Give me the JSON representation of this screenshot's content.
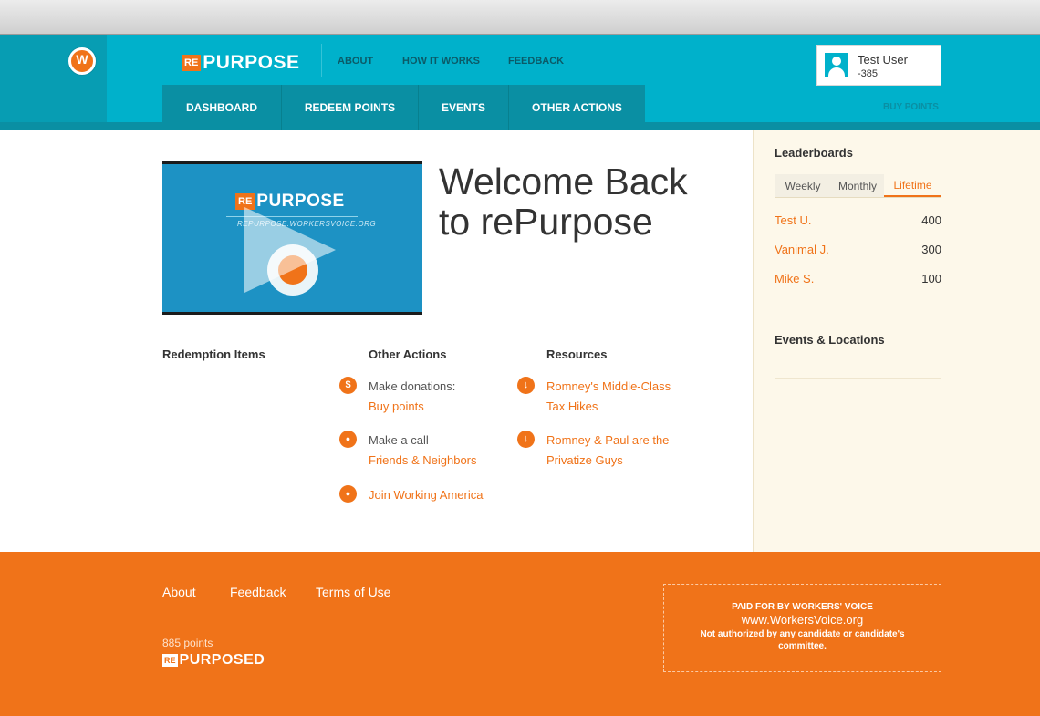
{
  "brand": {
    "prefix": "RE",
    "word": "PURPOSE"
  },
  "topnav": {
    "about": "ABOUT",
    "how_it_works": "HOW IT WORKS",
    "feedback": "FEEDBACK"
  },
  "tabs": [
    {
      "label": "DASHBOARD"
    },
    {
      "label": "REDEEM POINTS"
    },
    {
      "label": "EVENTS"
    },
    {
      "label": "OTHER ACTIONS"
    }
  ],
  "user": {
    "name": "Test User",
    "points": "-385"
  },
  "buy_points": "BUY POINTS",
  "video": {
    "prefix": "RE",
    "word": "PURPOSE",
    "url": "REPURPOSE.WORKERSVOICE.ORG"
  },
  "welcome": {
    "line1": "Welcome Back",
    "line2": "to rePurpose"
  },
  "columns": {
    "redemption": {
      "title": "Redemption Items"
    },
    "other_actions": {
      "title": "Other Actions",
      "items": [
        {
          "icon": "dollar-icon",
          "glyph": "$",
          "text": "Make donations:",
          "link": "Buy points"
        },
        {
          "icon": "person-icon",
          "glyph": "●",
          "text": "Make a call",
          "link": "Friends & Neighbors"
        },
        {
          "icon": "lightbulb-icon",
          "glyph": "●",
          "text": "",
          "link": "Join Working America"
        }
      ]
    },
    "resources": {
      "title": "Resources",
      "items": [
        {
          "icon": "download-icon",
          "glyph": "↓",
          "line1": "Romney's Middle-Class",
          "line2": "Tax Hikes"
        },
        {
          "icon": "download-icon",
          "glyph": "↓",
          "line1": "Romney & Paul are the",
          "line2": "Privatize Guys"
        }
      ]
    }
  },
  "sidebar": {
    "leaderboards_title": "Leaderboards",
    "tabs": {
      "weekly": "Weekly",
      "monthly": "Monthly",
      "lifetime": "Lifetime"
    },
    "rows": [
      {
        "name": "Test U.",
        "score": "400"
      },
      {
        "name": "Vanimal J.",
        "score": "300"
      },
      {
        "name": "Mike S.",
        "score": "100"
      }
    ],
    "events_title": "Events & Locations"
  },
  "footer": {
    "links": {
      "about": "About",
      "feedback": "Feedback",
      "terms": "Terms of Use"
    },
    "points": "885 points",
    "brand_prefix": "RE",
    "brand_word": "PURPOSED",
    "disclaimer": {
      "line1": "PAID FOR BY WORKERS' VOICE",
      "line2": "www.WorkersVoice.org",
      "line3": "Not authorized by any candidate or candidate's committee."
    }
  },
  "colors": {
    "teal": "#00b1cb",
    "orange": "#f07319",
    "cream": "#fdf8ea"
  }
}
